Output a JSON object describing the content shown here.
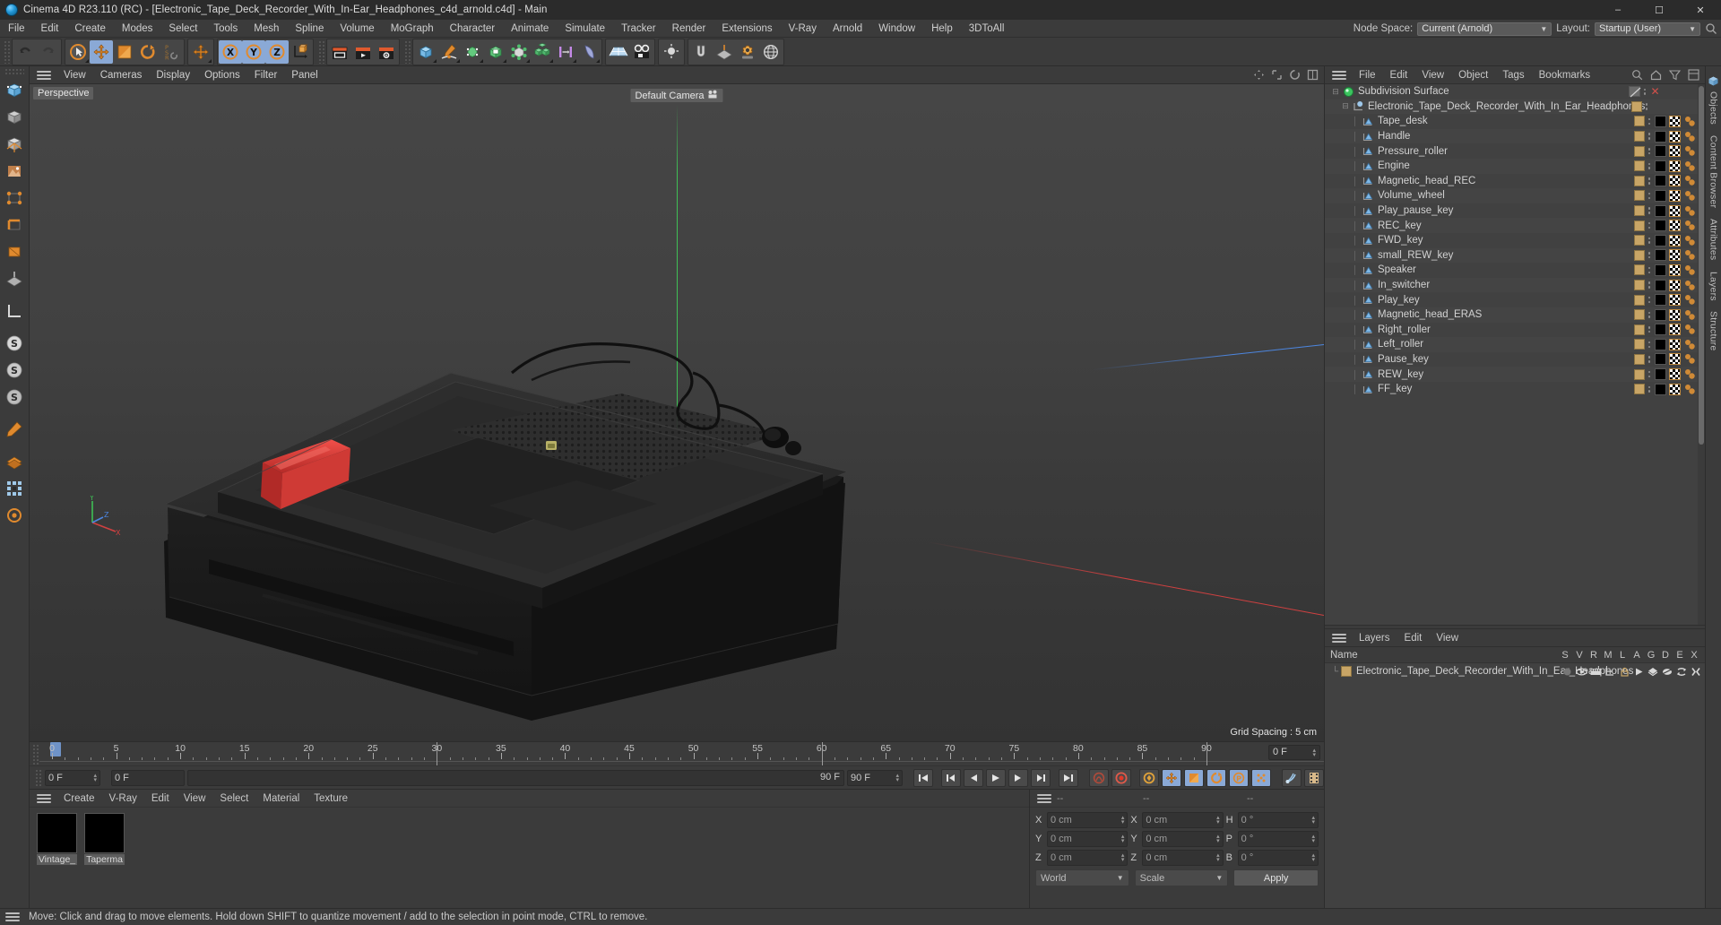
{
  "titlebar": {
    "app_icon": "cinema4d-logo-icon",
    "title": "Cinema 4D R23.110 (RC) - [Electronic_Tape_Deck_Recorder_With_In-Ear_Headphones_c4d_arnold.c4d] - Main",
    "minimize": "–",
    "maximize": "☐",
    "close": "✕"
  },
  "menubar": {
    "items": [
      "File",
      "Edit",
      "Create",
      "Modes",
      "Select",
      "Tools",
      "Mesh",
      "Spline",
      "Volume",
      "MoGraph",
      "Character",
      "Animate",
      "Simulate",
      "Tracker",
      "Render",
      "Extensions",
      "V-Ray",
      "Arnold",
      "Window",
      "Help",
      "3DToAll"
    ],
    "node_space_label": "Node Space:",
    "node_space_value": "Current (Arnold)",
    "layout_label": "Layout:",
    "layout_value": "Startup (User)"
  },
  "toolbar": {
    "groups": [
      {
        "name": "history",
        "buttons": [
          {
            "name": "undo-button",
            "icon": "undo-icon",
            "active": false
          },
          {
            "name": "redo-button",
            "icon": "redo-icon",
            "active": false
          }
        ]
      },
      {
        "name": "transform",
        "buttons": [
          {
            "name": "select-tool-button",
            "icon": "live-selection-icon",
            "active": false
          },
          {
            "name": "move-tool-button",
            "icon": "move-icon",
            "active": true
          },
          {
            "name": "scale-tool-button",
            "icon": "scale-icon",
            "active": false
          },
          {
            "name": "rotate-tool-button",
            "icon": "rotate-icon",
            "active": false
          },
          {
            "name": "psr-button",
            "icon": "psr-icon",
            "active": false
          }
        ]
      },
      {
        "name": "modeling-axis",
        "buttons": [
          {
            "name": "modeling-axis-button",
            "icon": "move-icon",
            "active": false
          }
        ]
      },
      {
        "name": "axis-lock",
        "buttons": [
          {
            "name": "x-axis-button",
            "icon": "x-axis-icon",
            "active": true
          },
          {
            "name": "y-axis-button",
            "icon": "y-axis-icon",
            "active": true
          },
          {
            "name": "z-axis-button",
            "icon": "z-axis-icon",
            "active": true
          },
          {
            "name": "world-coordinates-button",
            "icon": "world-coord-icon",
            "active": false
          }
        ]
      },
      {
        "name": "render",
        "buttons": [
          {
            "name": "render-view-button",
            "icon": "render-view-icon",
            "active": false
          },
          {
            "name": "render-to-picture-viewer-button",
            "icon": "render-picture-icon",
            "active": false
          },
          {
            "name": "render-settings-button",
            "icon": "render-settings-icon",
            "active": false
          }
        ]
      },
      {
        "name": "objects",
        "buttons": [
          {
            "name": "add-cube-button",
            "icon": "cube-icon",
            "active": false
          },
          {
            "name": "add-spline-button",
            "icon": "pen-spline-icon",
            "active": false
          },
          {
            "name": "nurbs-button",
            "icon": "nurbs-icon",
            "active": false
          },
          {
            "name": "array-button",
            "icon": "array-icon",
            "active": false
          },
          {
            "name": "deformer-button",
            "icon": "deformer-icon",
            "active": false
          },
          {
            "name": "mograph-button",
            "icon": "mograph-cubes-icon",
            "active": false
          },
          {
            "name": "scene-button",
            "icon": "scene-icon",
            "active": false
          },
          {
            "name": "field-button",
            "icon": "field-icon",
            "active": false
          }
        ]
      },
      {
        "name": "texture",
        "buttons": [
          {
            "name": "floor-button",
            "icon": "floor-grid-icon",
            "active": false
          },
          {
            "name": "camera-button",
            "icon": "camera-icon",
            "active": false
          }
        ]
      },
      {
        "name": "light",
        "buttons": [
          {
            "name": "light-button",
            "icon": "light-icon",
            "active": false
          }
        ]
      },
      {
        "name": "snap",
        "buttons": [
          {
            "name": "snap-button",
            "icon": "snap-magnet-icon",
            "active": false
          },
          {
            "name": "workplane-button",
            "icon": "workplane-icon",
            "active": false
          },
          {
            "name": "settings-button",
            "icon": "gear-icon",
            "active": false
          },
          {
            "name": "globe-button",
            "icon": "globe-icon",
            "active": false
          }
        ]
      }
    ]
  },
  "lefttools": [
    {
      "name": "left-tool-grip",
      "icon": "grip-icon"
    },
    {
      "name": "make-editable-button",
      "icon": "make-editable-icon"
    },
    {
      "name": "model-mode-button",
      "icon": "model-mode-icon"
    },
    {
      "name": "object-mode-button",
      "icon": "object-axis-icon"
    },
    {
      "name": "texture-mode-button",
      "icon": "texture-mode-icon"
    },
    {
      "name": "point-mode-button",
      "icon": "point-mode-icon"
    },
    {
      "name": "edge-mode-button",
      "icon": "edge-mode-icon"
    },
    {
      "name": "polygon-mode-button",
      "icon": "polygon-mode-icon"
    },
    {
      "name": "workplane-mode-button",
      "icon": "workplane-mode-icon"
    },
    {
      "name": "enable-axis-button",
      "icon": "axis-icon"
    },
    {
      "name": "soft-selection-s1-button",
      "icon": "s-circle-icon"
    },
    {
      "name": "soft-selection-s2-button",
      "icon": "s-circle-icon"
    },
    {
      "name": "soft-selection-s3-button",
      "icon": "s-circle-icon"
    },
    {
      "name": "viewport-solo-button",
      "icon": "solo-icon"
    },
    {
      "name": "layer-color-button",
      "icon": "layer-color-icon"
    },
    {
      "name": "quantize-button",
      "icon": "quantize-grid-icon"
    },
    {
      "name": "link-button",
      "icon": "link-icon"
    }
  ],
  "viewport": {
    "menu": [
      "View",
      "Cameras",
      "Display",
      "Options",
      "Filter",
      "Panel"
    ],
    "perspective_label": "Perspective",
    "camera_label": "Default Camera",
    "grid_spacing": "Grid Spacing : 5 cm",
    "axis_labels": {
      "x": "X",
      "y": "Y",
      "z": "Z"
    },
    "right_icons": [
      "pan-view-icon",
      "zoom-view-icon",
      "rotate-view-icon",
      "maximize-view-icon"
    ]
  },
  "timeline": {
    "labels": [
      "0",
      "5",
      "10",
      "15",
      "20",
      "25",
      "30",
      "35",
      "40",
      "45",
      "50",
      "55",
      "60",
      "65",
      "70",
      "75",
      "80",
      "85",
      "90"
    ],
    "min": 0,
    "max": 90,
    "current_frame": "0 F",
    "end_field": "0 F"
  },
  "transport": {
    "current_frame_field": "0 F",
    "preview_min_field": "0 F",
    "preview_max_field": "90 F",
    "end_frame_field": "90 F",
    "buttons": [
      {
        "name": "go-to-start-button",
        "icon": "skip-start-icon",
        "active": false
      },
      {
        "name": "go-to-previous-key-button",
        "icon": "prev-key-icon",
        "active": false
      },
      {
        "name": "go-back-one-frame-button",
        "icon": "step-back-icon",
        "active": false
      },
      {
        "name": "play-button",
        "icon": "play-icon",
        "active": false
      },
      {
        "name": "go-forward-one-frame-button",
        "icon": "step-forward-icon",
        "active": false
      },
      {
        "name": "go-to-next-key-button",
        "icon": "next-key-icon",
        "active": false
      },
      {
        "name": "go-to-end-button",
        "icon": "skip-end-icon",
        "active": false
      },
      {
        "name": "record-active-objects-button",
        "icon": "record-objects-icon",
        "active": false
      },
      {
        "name": "autokeying-button",
        "icon": "autokey-icon",
        "active": false
      },
      {
        "name": "keyframe-selection-button",
        "icon": "keyframe-select-icon",
        "active": false
      },
      {
        "name": "position-key-button",
        "icon": "position-key-icon",
        "active": true
      },
      {
        "name": "scale-key-button",
        "icon": "scale-key-icon",
        "active": true
      },
      {
        "name": "rotation-key-button",
        "icon": "rotation-key-icon",
        "active": true
      },
      {
        "name": "parameter-key-button",
        "icon": "param-key-icon",
        "active": true
      },
      {
        "name": "point-level-anim-button",
        "icon": "pla-icon",
        "active": true
      },
      {
        "name": "sound-button",
        "icon": "sound-icon",
        "active": false
      },
      {
        "name": "timeline-button",
        "icon": "filmstrip-icon",
        "active": false
      }
    ]
  },
  "material_manager": {
    "menu": [
      "Create",
      "V-Ray",
      "Edit",
      "View",
      "Select",
      "Material",
      "Texture"
    ],
    "materials": [
      {
        "name": "Vintage_",
        "selected": true
      },
      {
        "name": "Taperma",
        "selected": true
      }
    ]
  },
  "coordinates": {
    "header": [
      "--",
      "--",
      "--"
    ],
    "position": {
      "label_x": "X",
      "label_y": "Y",
      "label_z": "Z",
      "x": "0 cm",
      "y": "0 cm",
      "z": "0 cm"
    },
    "size": {
      "label_x": "X",
      "label_y": "Y",
      "label_z": "Z",
      "x": "0 cm",
      "y": "0 cm",
      "z": "0 cm"
    },
    "rotation": {
      "label_h": "H",
      "label_p": "P",
      "label_b": "B",
      "h": "0 °",
      "p": "0 °",
      "b": "0 °"
    },
    "coord_system": "World",
    "size_mode": "Scale",
    "apply_label": "Apply"
  },
  "object_manager": {
    "menu": [
      "File",
      "Edit",
      "View",
      "Object",
      "Tags",
      "Bookmarks"
    ],
    "right_icons": [
      "search-icon",
      "home-icon",
      "filter-icon",
      "layout-icon"
    ],
    "rows": [
      {
        "label": "Subdivision Surface",
        "depth": 0,
        "icon": "subdivision-surface-icon",
        "type": "generator",
        "has_tag": false,
        "has_visibility_dots": true,
        "has_material_tags": false,
        "closed_x": true
      },
      {
        "label": "Electronic_Tape_Deck_Recorder_With_In_Ear_Headphones",
        "depth": 1,
        "icon": "null-object-icon",
        "type": "null",
        "has_tag": true,
        "has_material_tags": false
      },
      {
        "label": "Tape_desk",
        "depth": 2,
        "icon": "polygon-object-icon",
        "type": "mesh",
        "has_tag": true,
        "has_material_tags": true
      },
      {
        "label": "Handle",
        "depth": 2,
        "icon": "polygon-object-icon",
        "type": "mesh",
        "has_tag": true,
        "has_material_tags": true
      },
      {
        "label": "Pressure_roller",
        "depth": 2,
        "icon": "polygon-object-icon",
        "type": "mesh",
        "has_tag": true,
        "has_material_tags": true
      },
      {
        "label": "Engine",
        "depth": 2,
        "icon": "polygon-object-icon",
        "type": "mesh",
        "has_tag": true,
        "has_material_tags": true
      },
      {
        "label": "Magnetic_head_REC",
        "depth": 2,
        "icon": "polygon-object-icon",
        "type": "mesh",
        "has_tag": true,
        "has_material_tags": true
      },
      {
        "label": "Volume_wheel",
        "depth": 2,
        "icon": "polygon-object-icon",
        "type": "mesh",
        "has_tag": true,
        "has_material_tags": true
      },
      {
        "label": "Play_pause_key",
        "depth": 2,
        "icon": "polygon-object-icon",
        "type": "mesh",
        "has_tag": true,
        "has_material_tags": true
      },
      {
        "label": "REC_key",
        "depth": 2,
        "icon": "polygon-object-icon",
        "type": "mesh",
        "has_tag": true,
        "has_material_tags": true
      },
      {
        "label": "FWD_key",
        "depth": 2,
        "icon": "polygon-object-icon",
        "type": "mesh",
        "has_tag": true,
        "has_material_tags": true
      },
      {
        "label": "small_REW_key",
        "depth": 2,
        "icon": "polygon-object-icon",
        "type": "mesh",
        "has_tag": true,
        "has_material_tags": true
      },
      {
        "label": "Speaker",
        "depth": 2,
        "icon": "polygon-object-icon",
        "type": "mesh",
        "has_tag": true,
        "has_material_tags": true
      },
      {
        "label": "In_switcher",
        "depth": 2,
        "icon": "polygon-object-icon",
        "type": "mesh",
        "has_tag": true,
        "has_material_tags": true
      },
      {
        "label": "Play_key",
        "depth": 2,
        "icon": "polygon-object-icon",
        "type": "mesh",
        "has_tag": true,
        "has_material_tags": true
      },
      {
        "label": "Magnetic_head_ERAS",
        "depth": 2,
        "icon": "polygon-object-icon",
        "type": "mesh",
        "has_tag": true,
        "has_material_tags": true
      },
      {
        "label": "Right_roller",
        "depth": 2,
        "icon": "polygon-object-icon",
        "type": "mesh",
        "has_tag": true,
        "has_material_tags": true
      },
      {
        "label": "Left_roller",
        "depth": 2,
        "icon": "polygon-object-icon",
        "type": "mesh",
        "has_tag": true,
        "has_material_tags": true
      },
      {
        "label": "Pause_key",
        "depth": 2,
        "icon": "polygon-object-icon",
        "type": "mesh",
        "has_tag": true,
        "has_material_tags": true
      },
      {
        "label": "REW_key",
        "depth": 2,
        "icon": "polygon-object-icon",
        "type": "mesh",
        "has_tag": true,
        "has_material_tags": true
      },
      {
        "label": "FF_key",
        "depth": 2,
        "icon": "polygon-object-icon",
        "type": "mesh",
        "has_tag": true,
        "has_material_tags": true
      }
    ]
  },
  "layers_manager": {
    "menu": [
      "Layers",
      "Edit",
      "View"
    ],
    "name_header": "Name",
    "columns": [
      "S",
      "V",
      "R",
      "M",
      "L",
      "A",
      "G",
      "D",
      "E",
      "X"
    ],
    "rows": [
      {
        "label": "Electronic_Tape_Deck_Recorder_With_In_Ear_Headphones",
        "color": "#c8a566"
      }
    ]
  },
  "right_tabs": [
    "Objects",
    "Content Browser",
    "Attributes",
    "Layers",
    "Structure"
  ],
  "statusbar": {
    "message": "Move: Click and drag to move elements. Hold down SHIFT to quantize movement / add to the selection in point mode, CTRL to remove."
  },
  "colors": {
    "accent_blue": "#8aa9d6",
    "orange": "#e08a2e",
    "tag_tan": "#c8a566",
    "panel_bg": "#3b3b3b",
    "list_bg": "#414141",
    "list_alt": "#444444",
    "axis_x": "#cf4040",
    "axis_y": "#3fbf55",
    "axis_z": "#4c86e0",
    "model_red": "#e03a36"
  }
}
